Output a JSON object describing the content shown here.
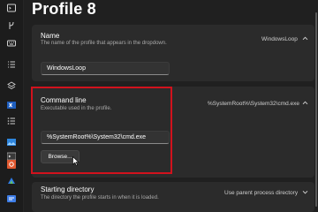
{
  "page": {
    "title": "Profile 8"
  },
  "sidebar": {
    "icons": [
      "command-prompt-icon",
      "branch-icon",
      "keyboard-icon",
      "list-icon",
      "layers-icon",
      "profile-x-icon",
      "list-bullets-icon",
      "image-icon",
      "terminal-icon",
      "orange-app-icon",
      "cloud-icon",
      "blue-app-icon"
    ]
  },
  "name_section": {
    "title": "Name",
    "description": "The name of the profile that appears in the dropdown.",
    "value": "WindowsLoop",
    "input_value": "WindowsLoop"
  },
  "command_line_section": {
    "title": "Command line",
    "description": "Executable used in the profile.",
    "value": "%SystemRoot%\\System32\\cmd.exe",
    "input_value": "%SystemRoot%\\System32\\cmd.exe",
    "browse_label": "Browse..."
  },
  "starting_directory_section": {
    "title": "Starting directory",
    "description": "The directory the profile starts in when it is loaded.",
    "value": "Use parent process directory"
  },
  "colors": {
    "background": "#202020",
    "card": "#2b2b2b",
    "highlight": "#d1121d"
  }
}
